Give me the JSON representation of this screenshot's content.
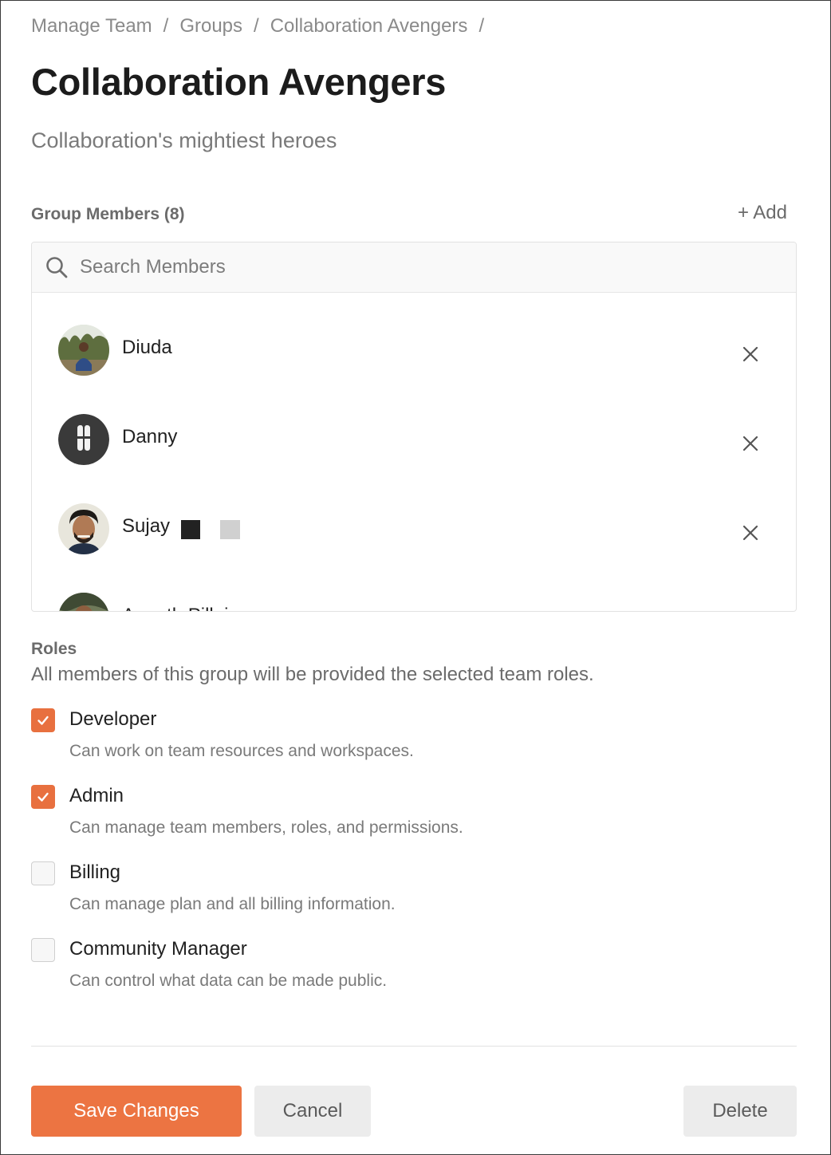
{
  "breadcrumb": {
    "items": [
      "Manage Team",
      "Groups",
      "Collaboration Avengers"
    ],
    "separator": "/"
  },
  "page": {
    "title": "Collaboration Avengers",
    "subtitle": "Collaboration's mightiest heroes"
  },
  "members": {
    "heading": "Group Members (8)",
    "add_label": "+ Add",
    "search_placeholder": "Search Members",
    "list": [
      {
        "name": "Diuda",
        "avatar": "photo-avatar"
      },
      {
        "name": "Danny",
        "avatar": "shoes-avatar"
      },
      {
        "name": "Sujay",
        "avatar": "photo-avatar"
      },
      {
        "name": "Ananth Pillai",
        "avatar": "photo-avatar"
      }
    ]
  },
  "roles": {
    "heading": "Roles",
    "description": "All members of this group will be provided the selected team roles.",
    "items": [
      {
        "name": "Developer",
        "description": "Can work on team resources and workspaces.",
        "checked": true
      },
      {
        "name": "Admin",
        "description": "Can manage team members, roles, and permissions.",
        "checked": true
      },
      {
        "name": "Billing",
        "description": "Can manage plan and all billing information.",
        "checked": false
      },
      {
        "name": "Community Manager",
        "description": "Can control what data can be made public.",
        "checked": false
      }
    ]
  },
  "actions": {
    "save_label": "Save Changes",
    "cancel_label": "Cancel",
    "delete_label": "Delete"
  },
  "colors": {
    "accent": "#ec7442",
    "checkbox_checked": "#e8703f",
    "secondary_button": "#ececec"
  }
}
